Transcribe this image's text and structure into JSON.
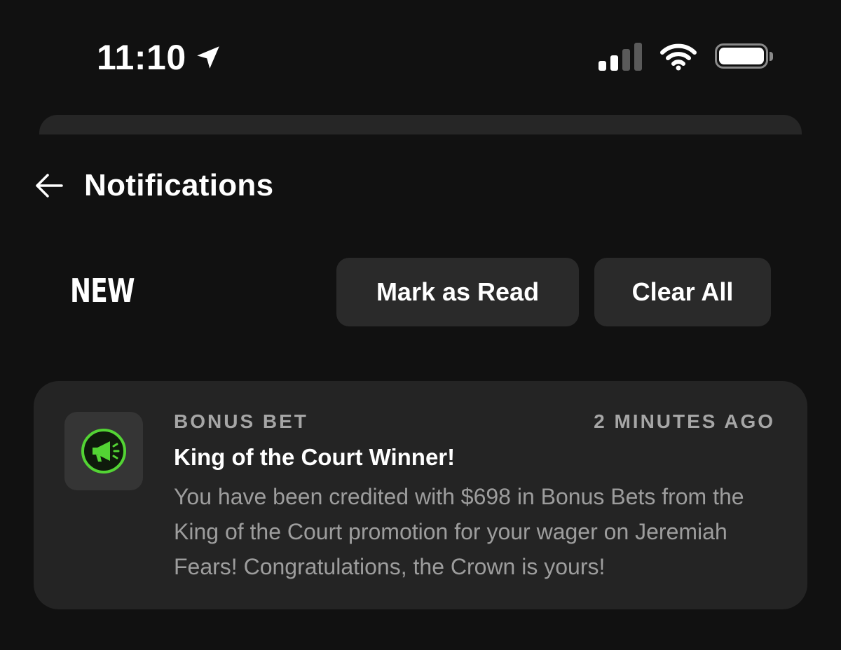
{
  "status_bar": {
    "time": "11:10"
  },
  "header": {
    "title": "Notifications"
  },
  "section": {
    "label": "NEW",
    "mark_as_read_label": "Mark as Read",
    "clear_all_label": "Clear All"
  },
  "notifications": [
    {
      "category": "BONUS BET",
      "time_ago": "2 MINUTES AGO",
      "title": "King of the Court Winner!",
      "body": "You have been credited with $698 in Bonus Bets from the King of the Court promotion for your wager on Jeremiah Fears! Congratulations, the Crown is yours!",
      "icon": "megaphone-icon"
    }
  ],
  "colors": {
    "background": "#111111",
    "card": "#242424",
    "button": "#2a2a2a",
    "accent_green": "#53d434",
    "muted_text": "#9d9d9d"
  }
}
